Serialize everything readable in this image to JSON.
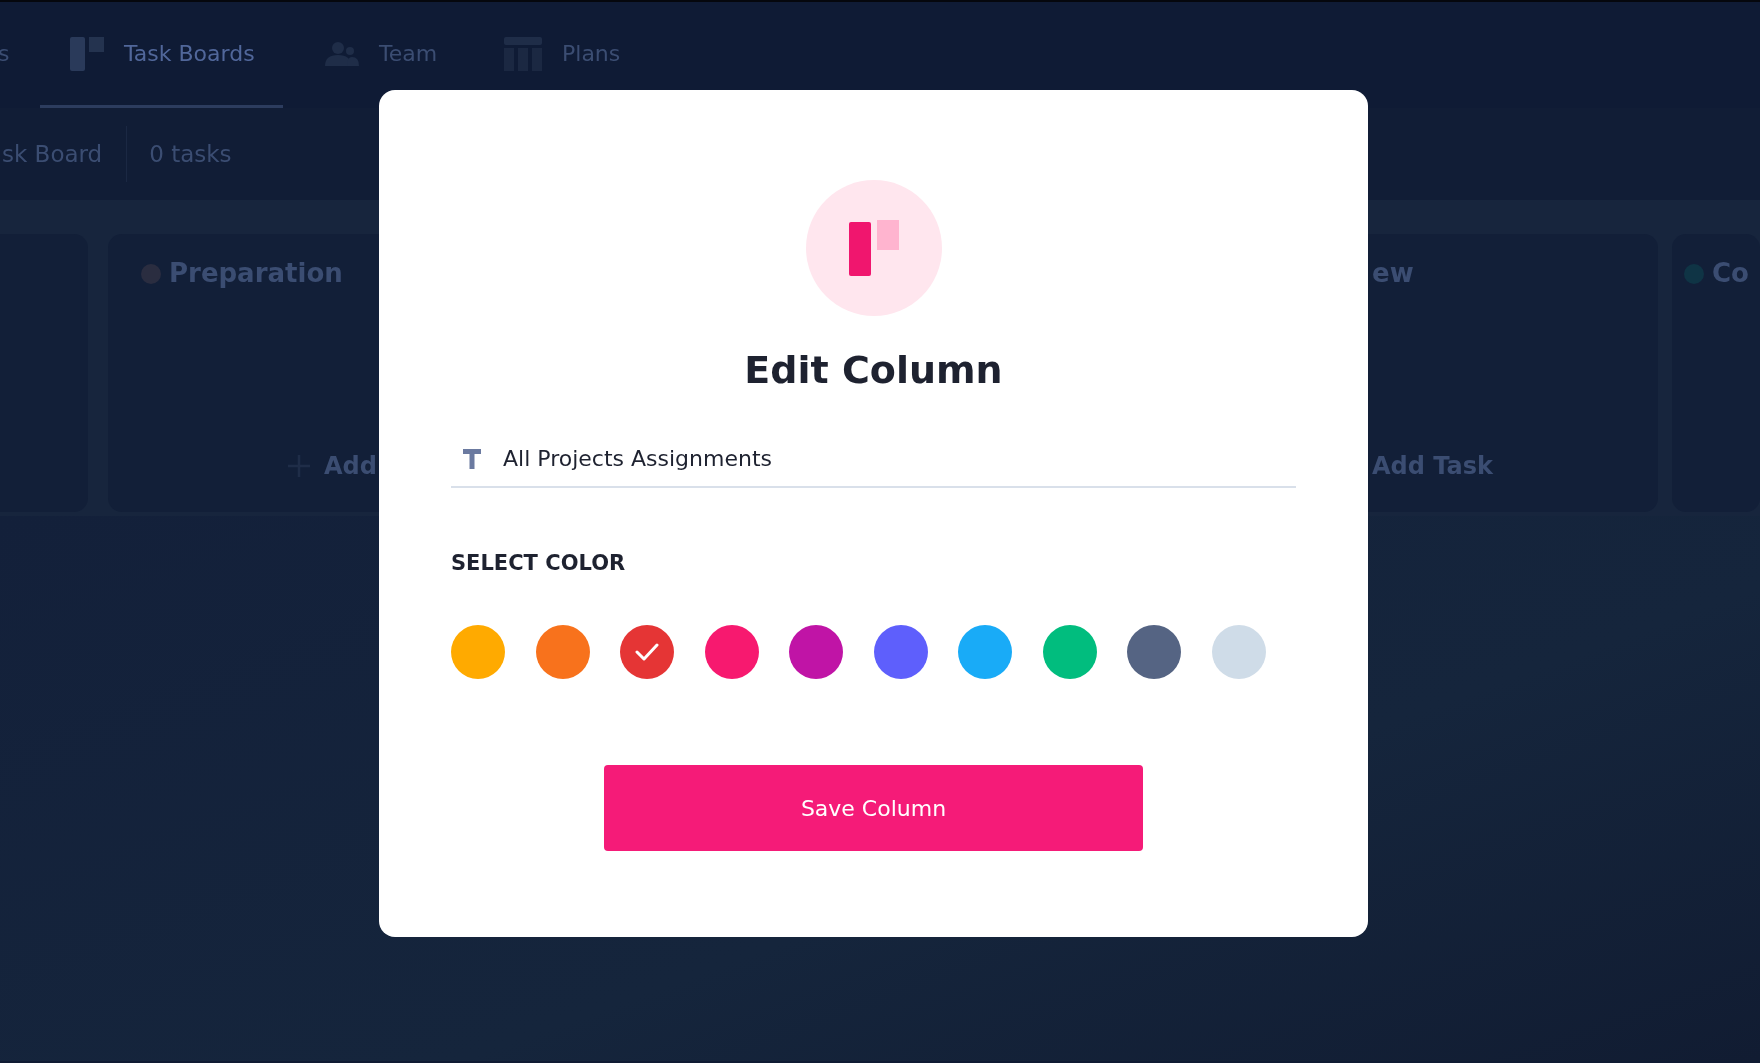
{
  "nav": {
    "tabs": [
      {
        "label": "s",
        "selected": false
      },
      {
        "label": "Task Boards",
        "selected": true
      },
      {
        "label": "Team",
        "selected": false
      },
      {
        "label": "Plans",
        "selected": false
      }
    ]
  },
  "subbar": {
    "board_title": "sk Board",
    "task_count": "0 tasks"
  },
  "board": {
    "columns": [
      {
        "title": "Preparation",
        "color": "#2a2d40",
        "add_label": "Add"
      },
      {
        "title": "ew",
        "add_label": "Add Task"
      },
      {
        "title": "Co",
        "color": "#0f3445"
      }
    ]
  },
  "modal": {
    "title": "Edit Column",
    "name_field": {
      "value": "All Projects Assignments"
    },
    "color_label": "SELECT COLOR",
    "colors": [
      {
        "color": "#ffaa00",
        "selected": false
      },
      {
        "color": "#f8721c",
        "selected": false
      },
      {
        "color": "#e53535",
        "selected": true
      },
      {
        "color": "#f7196f",
        "selected": false
      },
      {
        "color": "#c014a6",
        "selected": false
      },
      {
        "color": "#5e5ffc",
        "selected": false
      },
      {
        "color": "#19abf7",
        "selected": false
      },
      {
        "color": "#01bd7e",
        "selected": false
      },
      {
        "color": "#556483",
        "selected": false
      },
      {
        "color": "#cfdce8",
        "selected": false
      }
    ],
    "save_button": "Save Column"
  }
}
